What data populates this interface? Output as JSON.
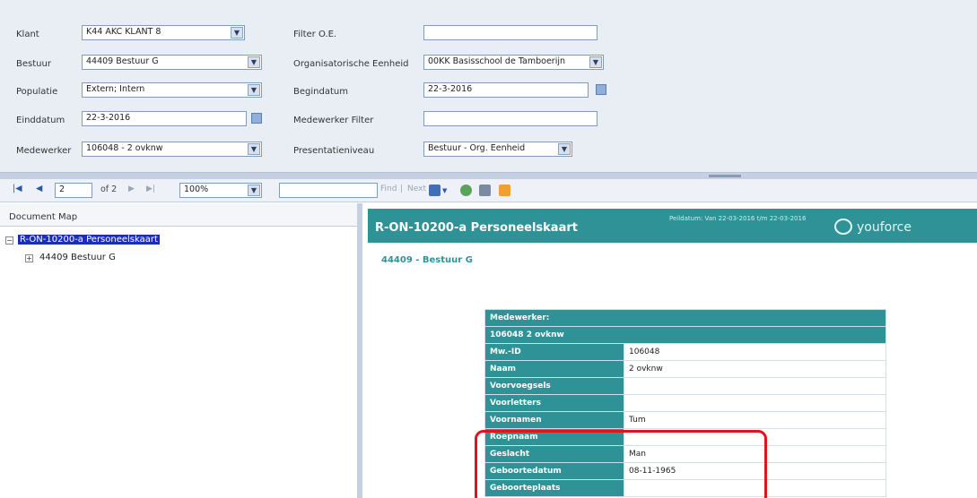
{
  "params": {
    "klant": {
      "label": "Klant",
      "value": "K44 AKC KLANT 8"
    },
    "bestuur": {
      "label": "Bestuur",
      "value": "44409 Bestuur G"
    },
    "populatie": {
      "label": "Populatie",
      "value": "Extern; Intern"
    },
    "einddatum": {
      "label": "Einddatum",
      "value": "22-3-2016"
    },
    "medewerker": {
      "label": "Medewerker",
      "value": "106048 - 2 ovknw"
    },
    "filter_oe": {
      "label": "Filter O.E.",
      "value": ""
    },
    "org_eenheid": {
      "label": "Organisatorische Eenheid",
      "value": "00KK Basisschool de Tamboerijn"
    },
    "begindatum": {
      "label": "Begindatum",
      "value": "22-3-2016"
    },
    "medewerker_filter": {
      "label": "Medewerker Filter",
      "value": ""
    },
    "presentatieniveau": {
      "label": "Presentatieniveau",
      "value": "Bestuur - Org. Eenheid"
    }
  },
  "toolbar": {
    "page_current": "2",
    "page_of": "of 2",
    "zoom": "100%",
    "find_value": "",
    "find_label": "Find",
    "next_label": "Next"
  },
  "docmap": {
    "header": "Document Map",
    "root": "R-ON-10200-a Personeelskaart",
    "child": "44409 Bestuur G"
  },
  "report": {
    "title": "R-ON-10200-a Personeelskaart",
    "period": "Peildatum: Van 22-03-2016 t/m 22-03-2016",
    "brand": "youforce",
    "subtitle": "44409 - Bestuur G",
    "card_header": "Medewerker:",
    "card_name": "106048 2 ovknw",
    "rows": [
      {
        "label": "Mw.-ID",
        "value": "106048"
      },
      {
        "label": "Naam",
        "value": "2 ovknw"
      },
      {
        "label": "Voorvoegsels",
        "value": ""
      },
      {
        "label": "Voorletters",
        "value": ""
      },
      {
        "label": "Voornamen",
        "value": "Tum"
      },
      {
        "label": "Roepnaam",
        "value": ""
      },
      {
        "label": "Geslacht",
        "value": "Man"
      },
      {
        "label": "Geboortedatum",
        "value": "08-11-1965"
      },
      {
        "label": "Geboorteplaats",
        "value": ""
      }
    ]
  },
  "colors": {
    "teal": "#2f9296",
    "highlight": "#e0141e",
    "selected": "#1a2fb8"
  }
}
